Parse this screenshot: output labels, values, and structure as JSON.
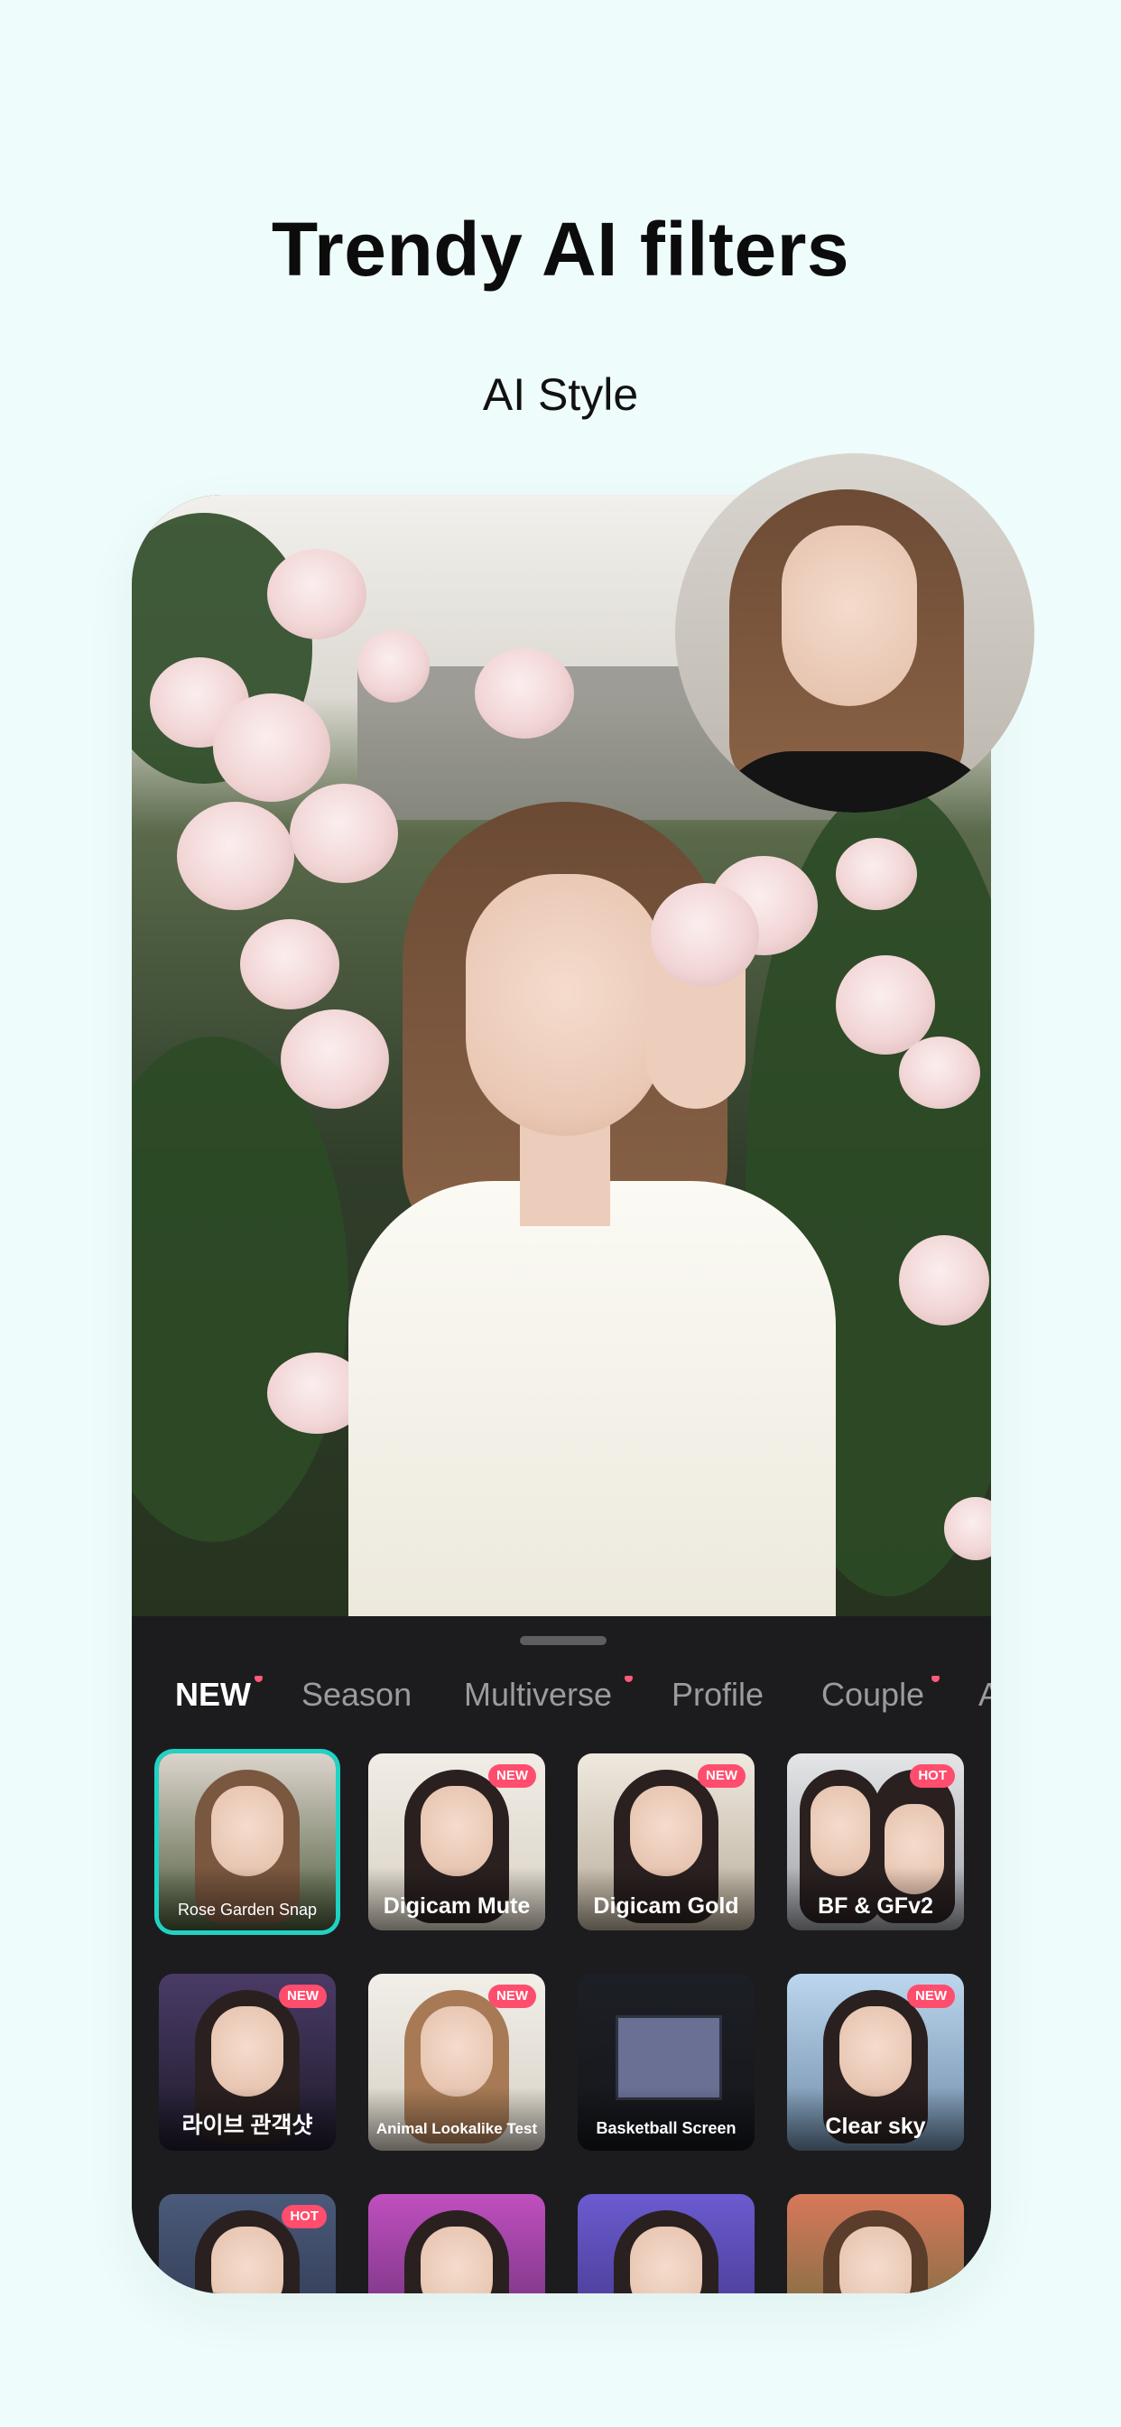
{
  "header": {
    "title": "Trendy AI filters",
    "subtitle": "AI Style"
  },
  "colors": {
    "accent": "#1fd3c4",
    "badge": "#ff4d6d",
    "sheet": "#1c1c1e",
    "background": "#eefcfb"
  },
  "tabs": [
    {
      "label": "NEW",
      "active": true,
      "dot": true
    },
    {
      "label": "Season",
      "active": false,
      "dot": false
    },
    {
      "label": "Multiverse",
      "active": false,
      "dot": true
    },
    {
      "label": "Profile",
      "active": false,
      "dot": false
    },
    {
      "label": "Couple",
      "active": false,
      "dot": true
    },
    {
      "label": "A",
      "active": false,
      "dot": false
    }
  ],
  "filters": [
    {
      "label": "Rose Garden Snap",
      "badge": "",
      "selected": true
    },
    {
      "label": "Digicam Mute",
      "badge": "NEW",
      "selected": false
    },
    {
      "label": "Digicam Gold",
      "badge": "NEW",
      "selected": false
    },
    {
      "label": "BF & GFv2",
      "badge": "HOT",
      "selected": false
    },
    {
      "label": "라이브 관객샷",
      "badge": "NEW",
      "selected": false
    },
    {
      "label": "Animal Lookalike Test",
      "badge": "NEW",
      "selected": false
    },
    {
      "label": "Basketball Screen",
      "badge": "",
      "selected": false
    },
    {
      "label": "Clear sky",
      "badge": "NEW",
      "selected": false
    },
    {
      "label": "",
      "badge": "HOT",
      "selected": false
    },
    {
      "label": "",
      "badge": "",
      "selected": false
    },
    {
      "label": "",
      "badge": "",
      "selected": false
    },
    {
      "label": "",
      "badge": "",
      "selected": false
    }
  ]
}
